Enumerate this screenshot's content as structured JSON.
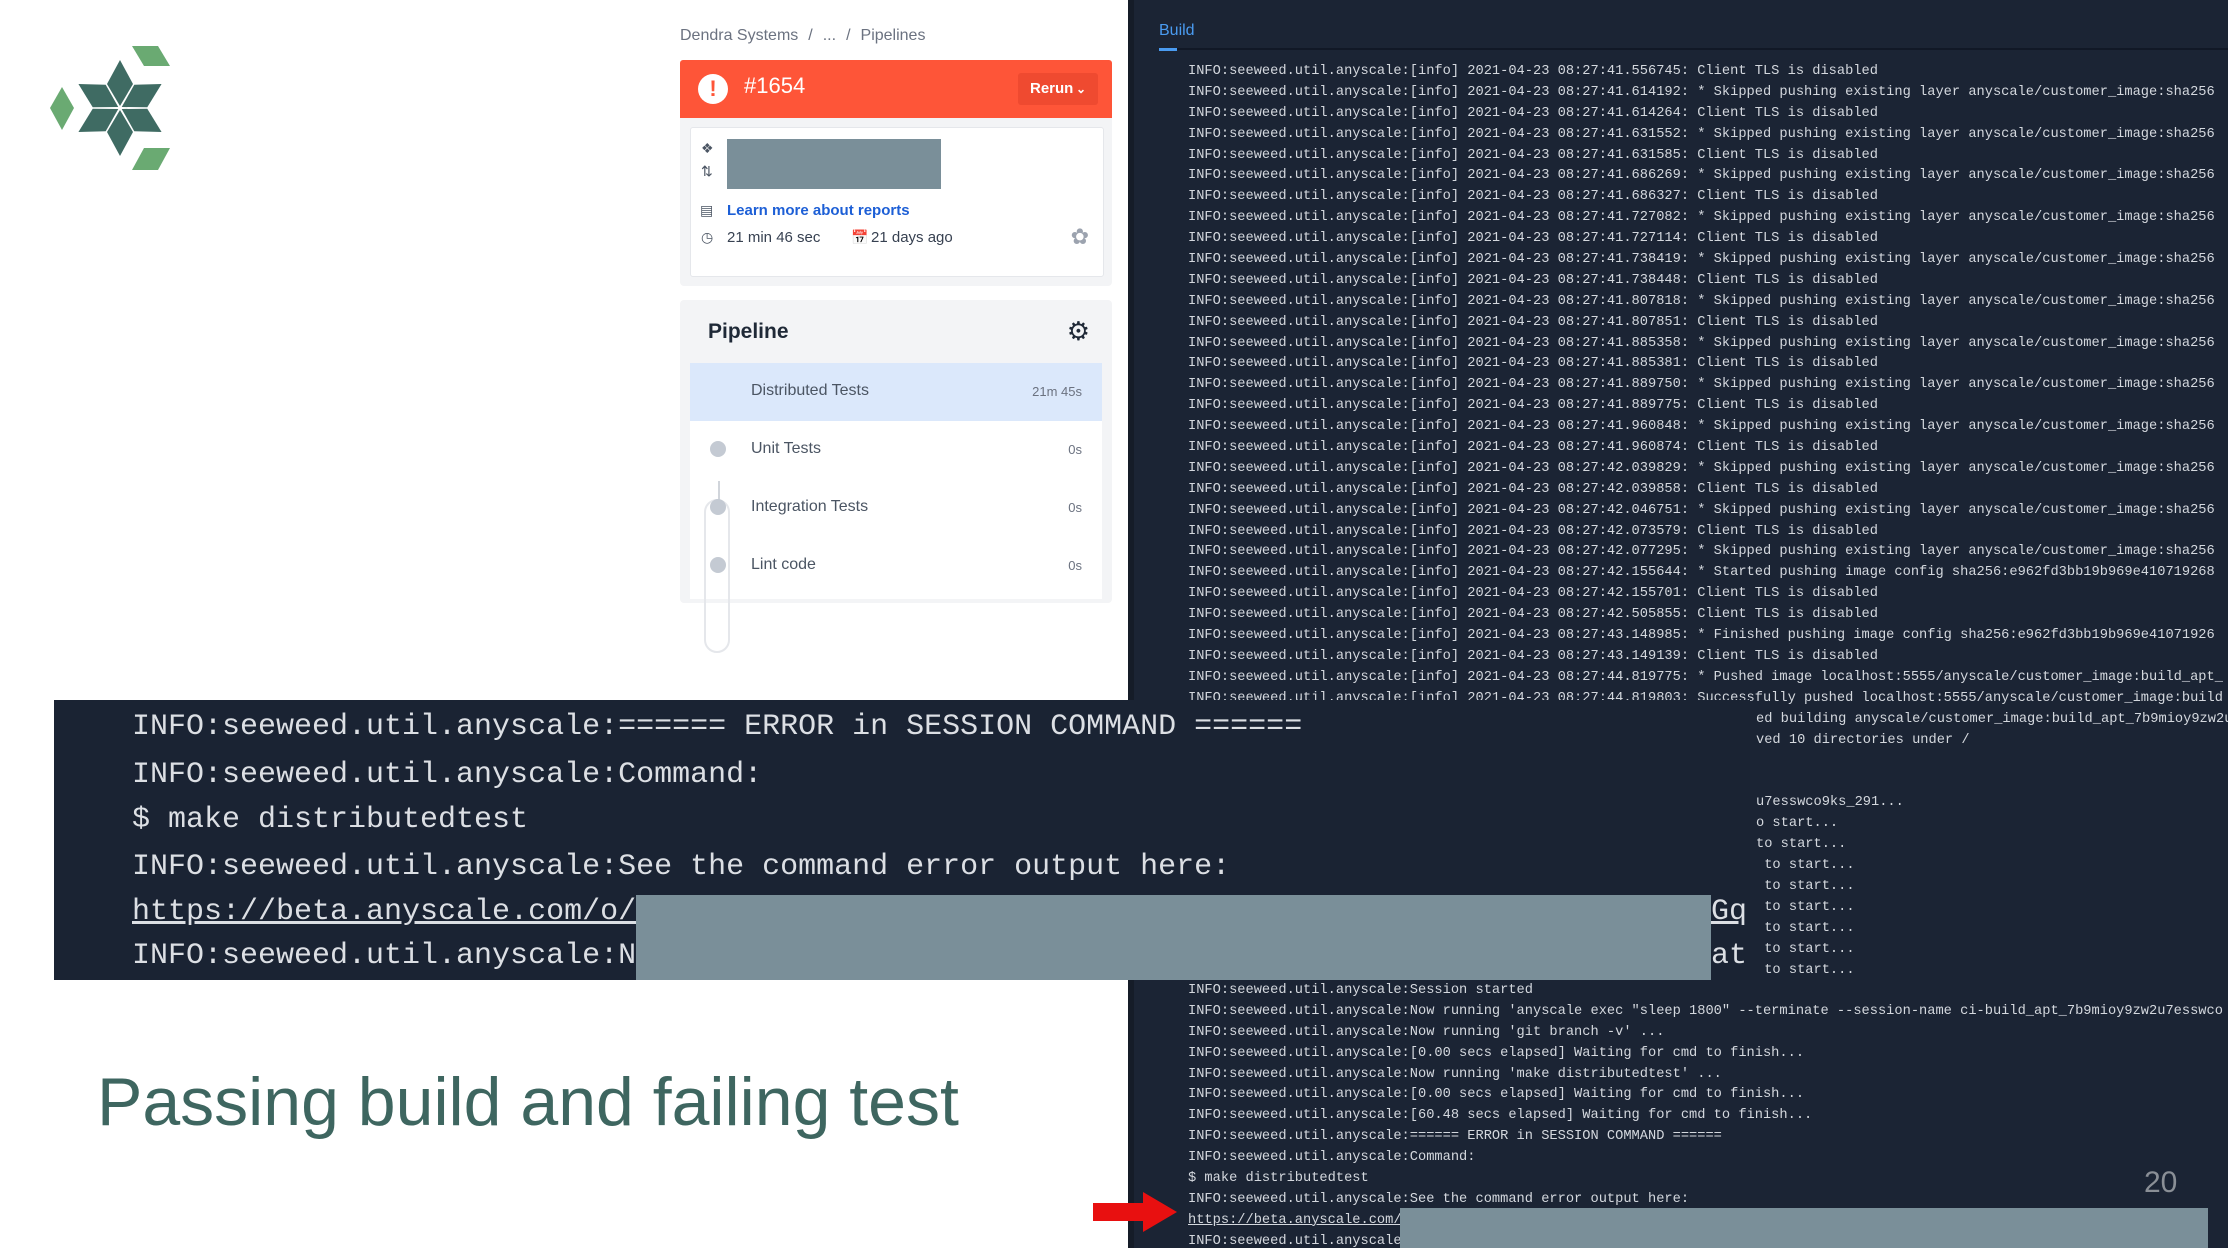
{
  "breadcrumb": {
    "items": [
      "Dendra Systems",
      "...",
      "Pipelines"
    ],
    "separator": "/"
  },
  "build": {
    "number": "#1654",
    "status": "failed",
    "rerun_label": "Rerun",
    "learn_more": "Learn more about reports",
    "duration": "21 min 46 sec",
    "age": "21 days ago",
    "status_color": "#fe5538"
  },
  "pipeline": {
    "title": "Pipeline",
    "steps": [
      {
        "label": "Distributed Tests",
        "duration": "21m 45s",
        "active": true
      },
      {
        "label": "Unit Tests",
        "duration": "0s"
      },
      {
        "label": "Integration Tests",
        "duration": "0s"
      },
      {
        "label": "Lint code",
        "duration": "0s"
      }
    ]
  },
  "log_panel": {
    "tab": "Build",
    "top_lines": [
      "INFO:seeweed.util.anyscale:[info] 2021-04-23 08:27:41.556745: Client TLS is disabled",
      "INFO:seeweed.util.anyscale:[info] 2021-04-23 08:27:41.614192: * Skipped pushing existing layer anyscale/customer_image:sha256",
      "INFO:seeweed.util.anyscale:[info] 2021-04-23 08:27:41.614264: Client TLS is disabled",
      "INFO:seeweed.util.anyscale:[info] 2021-04-23 08:27:41.631552: * Skipped pushing existing layer anyscale/customer_image:sha256",
      "INFO:seeweed.util.anyscale:[info] 2021-04-23 08:27:41.631585: Client TLS is disabled",
      "INFO:seeweed.util.anyscale:[info] 2021-04-23 08:27:41.686269: * Skipped pushing existing layer anyscale/customer_image:sha256",
      "INFO:seeweed.util.anyscale:[info] 2021-04-23 08:27:41.686327: Client TLS is disabled",
      "INFO:seeweed.util.anyscale:[info] 2021-04-23 08:27:41.727082: * Skipped pushing existing layer anyscale/customer_image:sha256",
      "INFO:seeweed.util.anyscale:[info] 2021-04-23 08:27:41.727114: Client TLS is disabled",
      "INFO:seeweed.util.anyscale:[info] 2021-04-23 08:27:41.738419: * Skipped pushing existing layer anyscale/customer_image:sha256",
      "INFO:seeweed.util.anyscale:[info] 2021-04-23 08:27:41.738448: Client TLS is disabled",
      "INFO:seeweed.util.anyscale:[info] 2021-04-23 08:27:41.807818: * Skipped pushing existing layer anyscale/customer_image:sha256",
      "INFO:seeweed.util.anyscale:[info] 2021-04-23 08:27:41.807851: Client TLS is disabled",
      "INFO:seeweed.util.anyscale:[info] 2021-04-23 08:27:41.885358: * Skipped pushing existing layer anyscale/customer_image:sha256",
      "INFO:seeweed.util.anyscale:[info] 2021-04-23 08:27:41.885381: Client TLS is disabled",
      "INFO:seeweed.util.anyscale:[info] 2021-04-23 08:27:41.889750: * Skipped pushing existing layer anyscale/customer_image:sha256",
      "INFO:seeweed.util.anyscale:[info] 2021-04-23 08:27:41.889775: Client TLS is disabled",
      "INFO:seeweed.util.anyscale:[info] 2021-04-23 08:27:41.960848: * Skipped pushing existing layer anyscale/customer_image:sha256",
      "INFO:seeweed.util.anyscale:[info] 2021-04-23 08:27:41.960874: Client TLS is disabled",
      "INFO:seeweed.util.anyscale:[info] 2021-04-23 08:27:42.039829: * Skipped pushing existing layer anyscale/customer_image:sha256",
      "INFO:seeweed.util.anyscale:[info] 2021-04-23 08:27:42.039858: Client TLS is disabled",
      "INFO:seeweed.util.anyscale:[info] 2021-04-23 08:27:42.046751: * Skipped pushing existing layer anyscale/customer_image:sha256",
      "INFO:seeweed.util.anyscale:[info] 2021-04-23 08:27:42.073579: Client TLS is disabled",
      "INFO:seeweed.util.anyscale:[info] 2021-04-23 08:27:42.077295: * Skipped pushing existing layer anyscale/customer_image:sha256",
      "INFO:seeweed.util.anyscale:[info] 2021-04-23 08:27:42.155644: * Started pushing image config sha256:e962fd3bb19b969e410719268",
      "INFO:seeweed.util.anyscale:[info] 2021-04-23 08:27:42.155701: Client TLS is disabled",
      "INFO:seeweed.util.anyscale:[info] 2021-04-23 08:27:42.505855: Client TLS is disabled",
      "INFO:seeweed.util.anyscale:[info] 2021-04-23 08:27:43.148985: * Finished pushing image config sha256:e962fd3bb19b969e41071926",
      "INFO:seeweed.util.anyscale:[info] 2021-04-23 08:27:43.149139: Client TLS is disabled",
      "INFO:seeweed.util.anyscale:[info] 2021-04-23 08:27:44.819775: * Pushed image localhost:5555/anyscale/customer_image:build_apt_",
      "INFO:seeweed.util.anyscale:[info] 2021-04-23 08:27:44.819803: Successfully pushed localhost:5555/anyscale/customer_image:build"
    ],
    "fragment_lines": [
      "",
      "ed building anyscale/customer_image:build_apt_7b9mioy9zw2u",
      "ved 10 directories under /",
      "",
      "",
      "u7esswco9ks_291...",
      "o start...",
      "to start...",
      " to start...",
      " to start...",
      " to start...",
      " to start...",
      " to start...",
      " to start..."
    ],
    "bottom_lines": [
      "INFO:seeweed.util.anyscale:Session started",
      "INFO:seeweed.util.anyscale:Now running 'anyscale exec \"sleep 1800\" --terminate --session-name ci-build_apt_7b9mioy9zw2u7esswco",
      "INFO:seeweed.util.anyscale:Now running 'git branch -v' ...",
      "INFO:seeweed.util.anyscale:[0.00 secs elapsed] Waiting for cmd to finish...",
      "INFO:seeweed.util.anyscale:Now running 'make distributedtest' ...",
      "INFO:seeweed.util.anyscale:[0.00 secs elapsed] Waiting for cmd to finish...",
      "INFO:seeweed.util.anyscale:[60.48 secs elapsed] Waiting for cmd to finish...",
      "INFO:seeweed.util.anyscale:====== ERROR in SESSION COMMAND ======",
      "INFO:seeweed.util.anyscale:Command:",
      "$ make distributedtest",
      "INFO:seeweed.util.anyscale:See the command error output here:",
      "https://beta.anyscale.com/",
      "INFO:seeweed.util.anyscale"
    ]
  },
  "zoomed_excerpt": {
    "lines": [
      "INFO:seeweed.util.anyscale:====== ERROR in SESSION COMMAND ======",
      "INFO:seeweed.util.anyscale:Command:",
      "$ make distributedtest",
      "INFO:seeweed.util.anyscale:See the command error output here:",
      "https://beta.anyscale.com/o/",
      "INFO:seeweed.util.anyscale:N"
    ],
    "tails": [
      "Gq",
      "at"
    ]
  },
  "slide": {
    "title": "Passing build and failing test",
    "page_number": "20",
    "title_color": "#3e6660"
  },
  "colors": {
    "panel_bg": "#1b2434",
    "redaction": "#7a8f99",
    "link": "#1d5fd6",
    "accent_tab": "#4a9bf0",
    "arrow": "#e81010"
  }
}
